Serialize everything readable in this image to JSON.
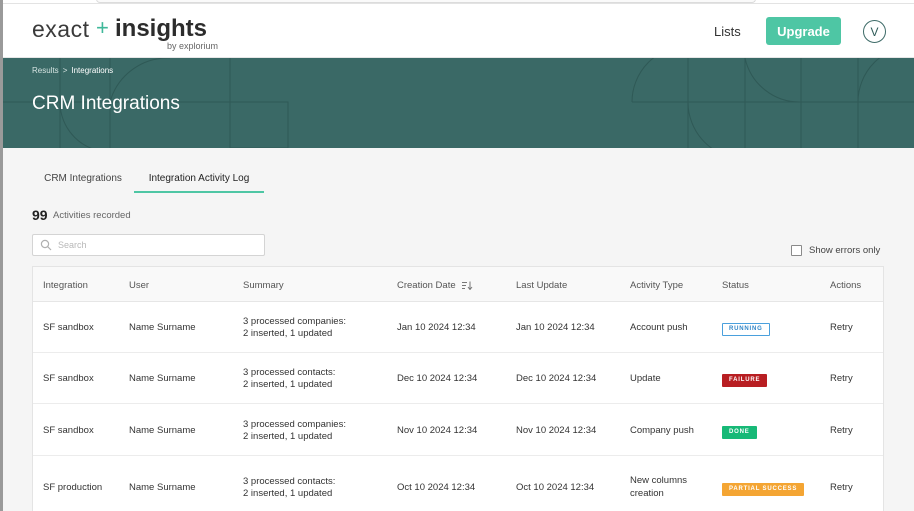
{
  "header": {
    "logo_exact": "exact",
    "logo_plus": "+",
    "logo_insights": "insights",
    "logo_by": "by explorium",
    "nav_lists": "Lists",
    "upgrade_label": "Upgrade",
    "avatar_initial": "V"
  },
  "hero": {
    "breadcrumb_root": "Results",
    "breadcrumb_sep": ">",
    "breadcrumb_current": "Integrations",
    "title": "CRM Integrations",
    "bg_color": "#3a6966"
  },
  "tabs": [
    {
      "label": "CRM Integrations",
      "active": false
    },
    {
      "label": "Integration Activity Log",
      "active": true
    }
  ],
  "activities": {
    "count": "99",
    "count_label": "Activities recorded"
  },
  "search": {
    "placeholder": "Search",
    "icon": "search-icon"
  },
  "filters": {
    "show_errors_label": "Show errors only",
    "show_errors_checked": false
  },
  "table": {
    "columns": [
      "Integration",
      "User",
      "Summary",
      "Creation Date",
      "Last Update",
      "Activity Type",
      "Status",
      "Actions"
    ],
    "sort_icon": "sort-descending-icon",
    "rows": [
      {
        "integration": "SF sandbox",
        "user": "Name Surname",
        "summary_1": "3 processed companies:",
        "summary_2": "2 inserted, 1 updated",
        "creation_date": "Jan 10 2024 12:34",
        "last_update": "Jan 10 2024 12:34",
        "activity_type": "Account push",
        "status": "RUNNING",
        "action": "Retry"
      },
      {
        "integration": "SF sandbox",
        "user": "Name Surname",
        "summary_1": "3 processed contacts:",
        "summary_2": "2 inserted, 1 updated",
        "creation_date": "Dec 10 2024 12:34",
        "last_update": "Dec 10 2024 12:34",
        "activity_type": "Update",
        "status": "FAILURE",
        "action": "Retry"
      },
      {
        "integration": "SF sandbox",
        "user": "Name Surname",
        "summary_1": "3 processed companies:",
        "summary_2": "2 inserted, 1 updated",
        "creation_date": "Nov 10 2024 12:34",
        "last_update": "Nov 10 2024 12:34",
        "activity_type": "Company push",
        "status": "DONE",
        "action": "Retry"
      },
      {
        "integration": "SF production",
        "user": "Name Surname",
        "summary_1": "3 processed contacts:",
        "summary_2": "2 inserted, 1 updated",
        "creation_date": "Oct 10 2024 12:34",
        "last_update": "Oct 10 2024 12:34",
        "activity_type_1": "New columns",
        "activity_type_2": "creation",
        "status": "PARTIAL SUCCESS",
        "action": "Retry"
      }
    ]
  },
  "colors": {
    "accent": "#4ec6a4",
    "running": "#2f85c7",
    "failure": "#b81e22",
    "done": "#17b977",
    "partial": "#f4a533"
  }
}
